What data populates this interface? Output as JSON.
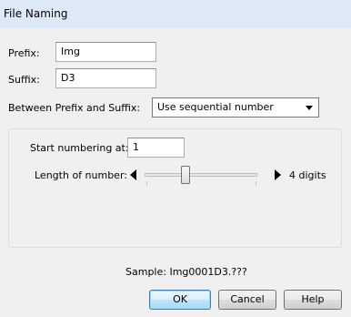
{
  "window": {
    "title": "File Naming"
  },
  "prefix": {
    "label": "Prefix:",
    "value": "Img"
  },
  "suffix": {
    "label": "Suffix:",
    "value": "D3"
  },
  "between": {
    "label": "Between Prefix and Suffix:",
    "selected": "Use sequential number"
  },
  "numbering": {
    "start_label": "Start numbering at:",
    "start_value": "1",
    "length_label": "Length of number:",
    "length_value_text": "4 digits",
    "length_digits": 4
  },
  "sample": {
    "text": "Sample: Img0001D3.???"
  },
  "buttons": {
    "ok": "OK",
    "cancel": "Cancel",
    "help": "Help"
  }
}
